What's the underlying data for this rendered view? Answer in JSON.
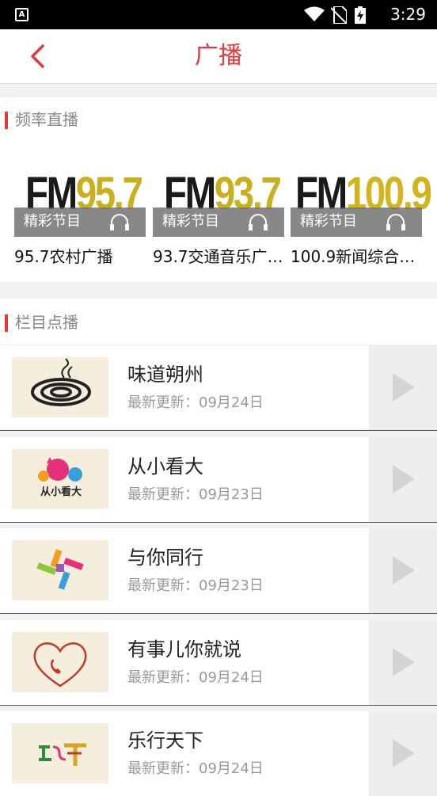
{
  "status_bar": {
    "time": "3:29",
    "notification_icon_letter": "A"
  },
  "app_bar": {
    "title": "广播",
    "back_icon": "chevron-left-icon",
    "accent_color": "#e03a3a"
  },
  "frequency_section": {
    "heading": "频率直播",
    "cards": [
      {
        "logo_prefix": "FM",
        "logo_number": "95.7",
        "overlay_label": "精彩节目",
        "name": "95.7农村广播"
      },
      {
        "logo_prefix": "FM",
        "logo_number": "93.7",
        "overlay_label": "精彩节目",
        "name": "93.7交通音乐广…"
      },
      {
        "logo_prefix": "FM",
        "logo_number": "100.9",
        "overlay_label": "精彩节目",
        "name": "100.9新闻综合…"
      }
    ]
  },
  "program_section": {
    "heading": "栏目点播",
    "items": [
      {
        "title": "味道朔州",
        "updated": "最新更新：09月24日"
      },
      {
        "title": "从小看大",
        "updated": "最新更新：09月23日"
      },
      {
        "title": "与你同行",
        "updated": "最新更新：09月23日"
      },
      {
        "title": "有事儿你就说",
        "updated": "最新更新：09月24日"
      },
      {
        "title": "乐行天下",
        "updated": "最新更新：09月24日"
      }
    ]
  }
}
